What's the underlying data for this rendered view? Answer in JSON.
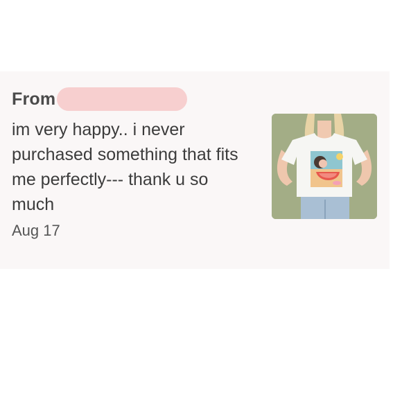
{
  "review": {
    "from_label": "From",
    "message": "im very happy.. i never purchased something that fits me perfectly--- thank u so much",
    "date": "Aug 17"
  },
  "thumbnail": {
    "icon": "product-photo"
  },
  "colors": {
    "card_background": "#faf7f7",
    "redaction": "#f7cfcf",
    "text": "#3c3c3c",
    "thumb_background": "#a3ad86"
  }
}
